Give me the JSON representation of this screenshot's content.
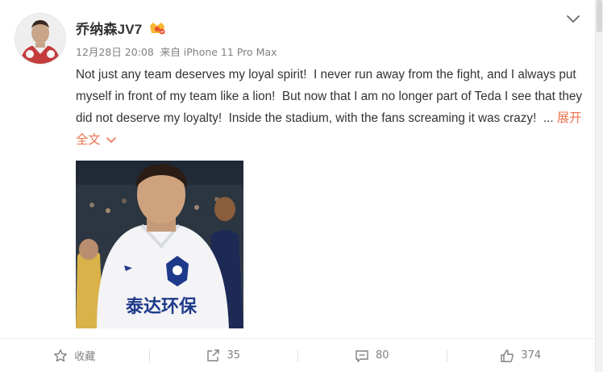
{
  "post": {
    "author": "乔纳森JV7",
    "meta": {
      "date": "12月28日 20:08",
      "source": "来自 iPhone 11 Pro Max"
    },
    "text": "Not just any team deserves my loyal spirit!  I never run away from the fight, and I always put myself in front of my team like a lion!  But now that I am no longer part of Teda I see that they did not deserve my loyalty!  Inside the stadium, with the fans screaming it was crazy!  ... ",
    "expand_label": "展开全文",
    "photo": {
      "shirt_text": "泰达环保"
    }
  },
  "actions": {
    "favorite_label": "收藏",
    "repost_count": "35",
    "comment_count": "80",
    "like_count": "374"
  },
  "colors": {
    "accent": "#eb7350",
    "text": "#333333",
    "muted": "#808080",
    "shirt_blue": "#1f3a8a"
  },
  "icons": [
    "avatar",
    "vip-badge-icon",
    "chevron-down-icon",
    "star-icon",
    "repost-icon",
    "comment-icon",
    "thumbs-up-icon"
  ]
}
